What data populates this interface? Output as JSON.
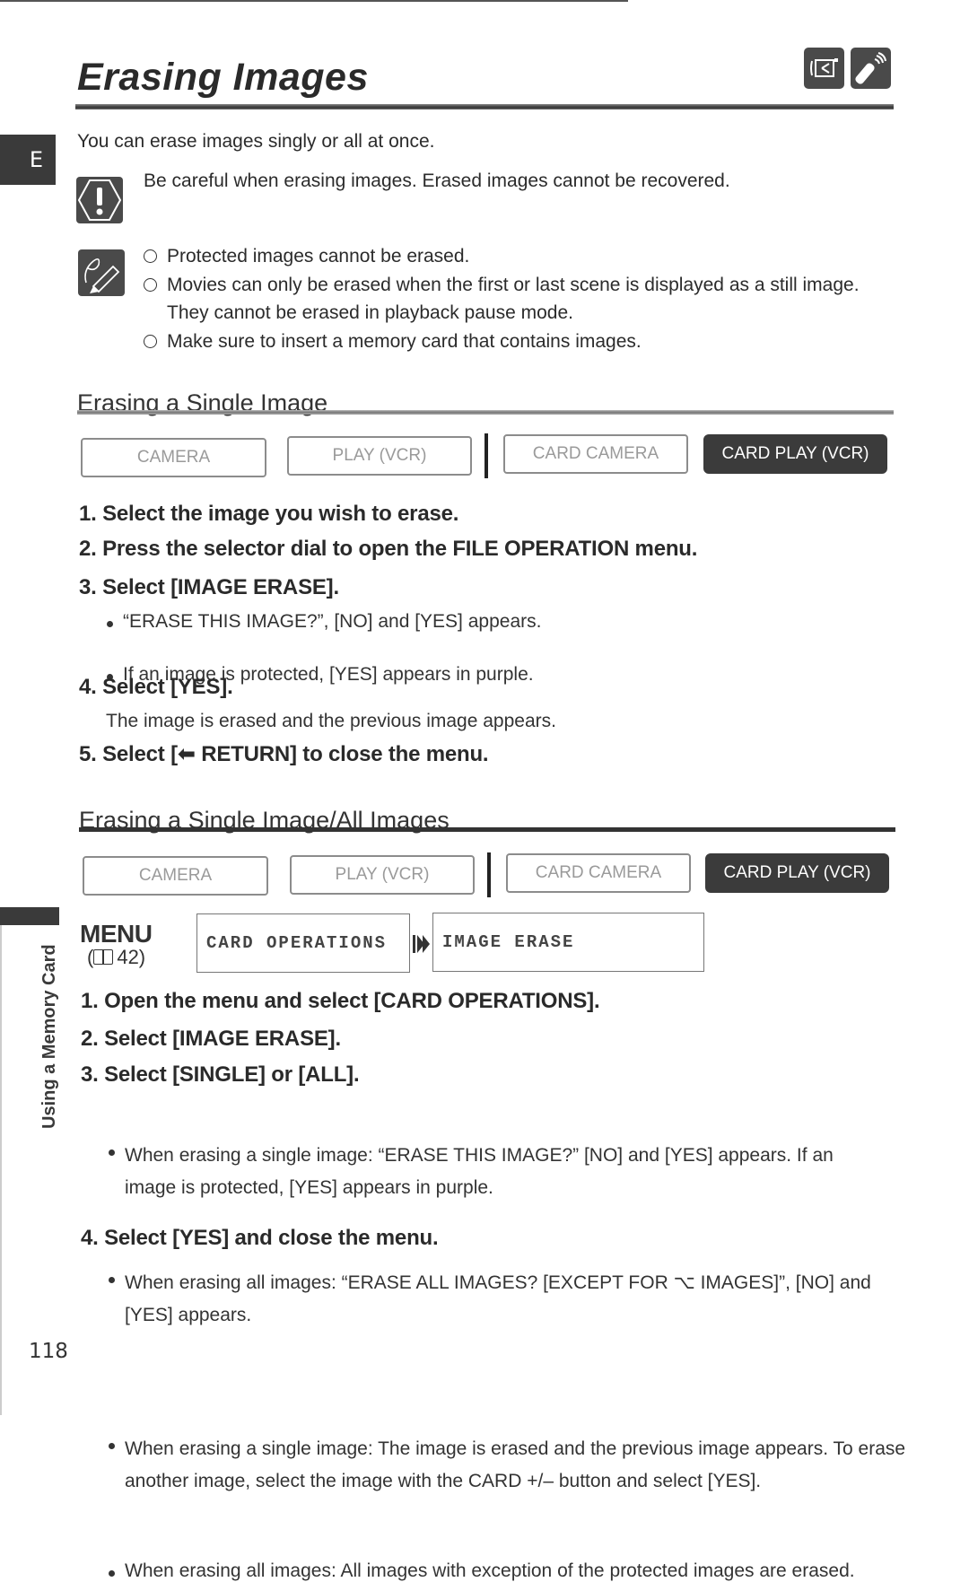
{
  "page": {
    "title": "Erasing Images",
    "language_tab": "E",
    "header_icons": [
      "camcorder-icon",
      "remote-control-icon"
    ],
    "intro": "You can erase images singly or all at once.",
    "caution": {
      "icon": "caution-icon",
      "text": "Be careful when erasing images. Erased images cannot be recovered."
    },
    "notes": {
      "icon": "note-pencil-icon",
      "items": [
        "Protected images cannot be erased.",
        "Movies can only be erased when the first or last scene is displayed as a still image. They cannot be erased in playback pause mode.",
        "Make sure to insert a memory card that contains images."
      ]
    },
    "side_label": "Using a Memory Card",
    "page_number": "118"
  },
  "modes": {
    "labels": [
      "CAMERA",
      "PLAY (VCR)",
      "CARD CAMERA",
      "CARD PLAY (VCR)"
    ],
    "active": "CARD PLAY (VCR)"
  },
  "section1": {
    "title": "Erasing a Single Image",
    "steps": [
      "1. Select the image you wish to erase.",
      "2. Press the selector dial to open the FILE OPERATION menu.",
      "3. Select [IMAGE ERASE].",
      "4. Select [YES].",
      "5. Select [⬅ RETURN] to close the menu."
    ],
    "step3_bullets": [
      "“ERASE THIS IMAGE?”, [NO] and [YES] appears.",
      "If an image is protected, [YES] appears in purple."
    ],
    "step4_text": "The image is erased and the previous image appears."
  },
  "section2": {
    "title": "Erasing a Single Image/All Images",
    "menu": {
      "label": "MENU",
      "ref": "(🕮 42)",
      "path": [
        "CARD OPERATIONS",
        "IMAGE ERASE"
      ]
    },
    "steps": [
      "1. Open the menu and select [CARD OPERATIONS].",
      "2. Select [IMAGE ERASE].",
      "3. Select [SINGLE] or [ALL].",
      "4. Select [YES] and close the menu."
    ],
    "step3_bullets": [
      "When erasing a single image: “ERASE THIS IMAGE?” [NO] and [YES] appears. If an image is protected, [YES] appears in purple.",
      "When erasing all images: “ERASE ALL IMAGES? [EXCEPT FOR ⌥ IMAGES]”, [NO] and [YES] appears."
    ],
    "step4_bullets": [
      "When erasing a single image: The image is erased and the previous image appears. To erase another image, select the image with the CARD +/– button and select [YES].",
      "When erasing all images: All images with exception of the protected images are erased."
    ]
  }
}
